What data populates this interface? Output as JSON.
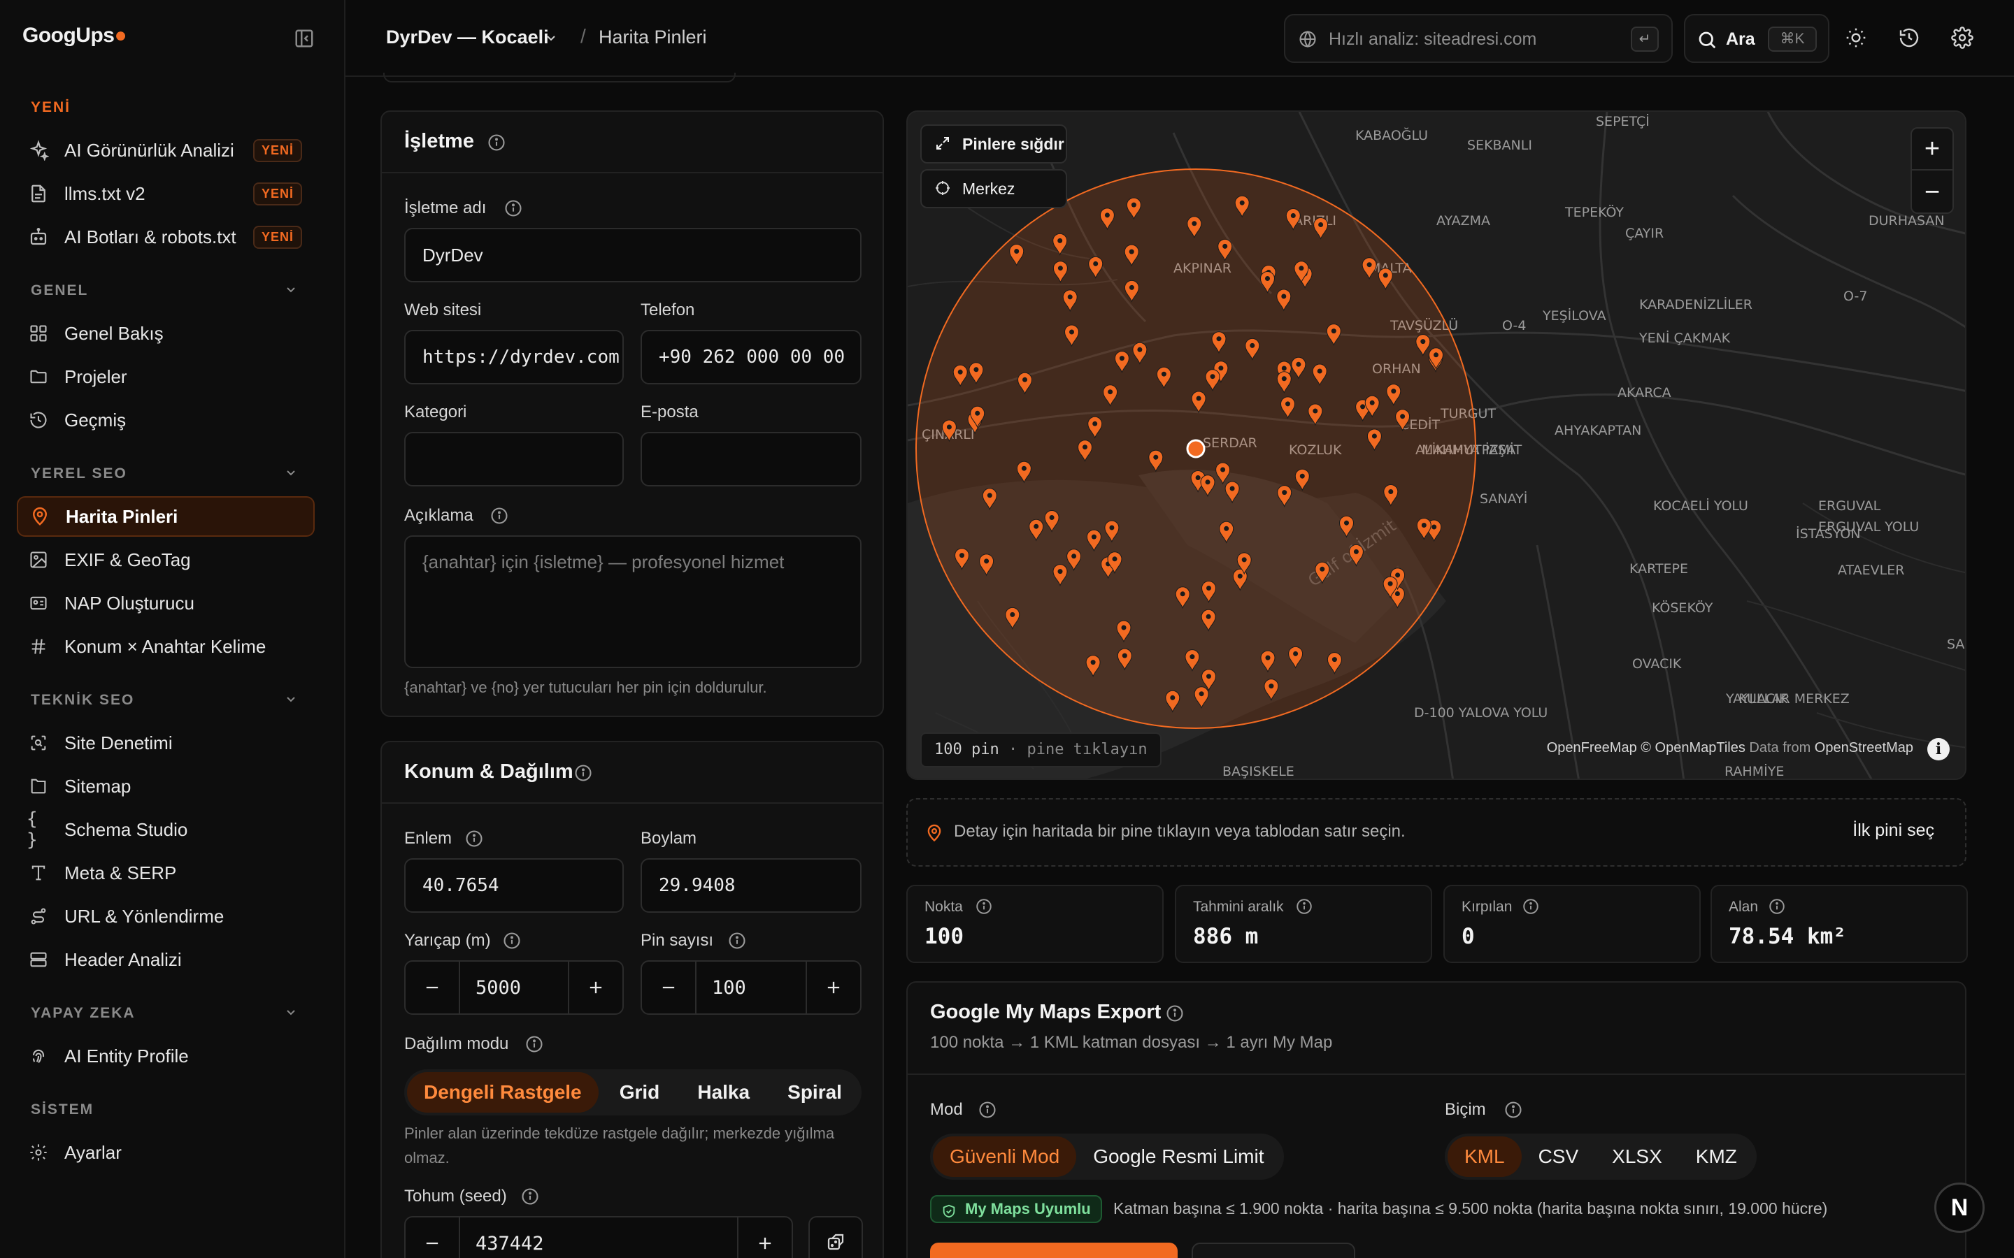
{
  "app": {
    "brand": "GoogUps",
    "accent": "#f26a21"
  },
  "sidebar": {
    "sections": [
      {
        "title": "YENİ",
        "items": [
          {
            "label": "AI Görünürlük Analizi",
            "badge": "YENİ",
            "icon": "sparkle-icon"
          },
          {
            "label": "llms.txt v2",
            "badge": "YENİ",
            "icon": "document-icon"
          },
          {
            "label": "AI Botları & robots.txt",
            "badge": "YENİ",
            "icon": "bot-icon"
          }
        ]
      },
      {
        "title": "GENEL",
        "items": [
          {
            "label": "Genel Bakış",
            "icon": "grid-icon"
          },
          {
            "label": "Projeler",
            "icon": "folder-icon"
          },
          {
            "label": "Geçmiş",
            "icon": "history-icon"
          }
        ]
      },
      {
        "title": "YEREL SEO",
        "items": [
          {
            "label": "Harita Pinleri",
            "icon": "map-pin-icon",
            "active": true
          },
          {
            "label": "EXIF & GeoTag",
            "icon": "image-icon"
          },
          {
            "label": "NAP Oluşturucu",
            "icon": "id-card-icon"
          },
          {
            "label": "Konum × Anahtar Kelime",
            "icon": "hash-icon"
          }
        ]
      },
      {
        "title": "TEKNİK SEO",
        "items": [
          {
            "label": "Site Denetimi",
            "icon": "scan-icon"
          },
          {
            "label": "Sitemap",
            "icon": "sitemap-icon"
          },
          {
            "label": "Schema Studio",
            "icon": "braces-icon"
          },
          {
            "label": "Meta & SERP",
            "icon": "type-icon"
          },
          {
            "label": "URL & Yönlendirme",
            "icon": "route-icon"
          },
          {
            "label": "Header Analizi",
            "icon": "server-icon"
          }
        ]
      },
      {
        "title": "YAPAY ZEKA",
        "items": [
          {
            "label": "AI Entity Profile",
            "icon": "fingerprint-icon"
          }
        ]
      },
      {
        "title": "SİSTEM",
        "items": [
          {
            "label": "Ayarlar",
            "icon": "gear-icon"
          }
        ]
      }
    ]
  },
  "topbar": {
    "project": "DyrDev — Kocaeli",
    "separator": "/",
    "page": "Harita Pinleri",
    "quick_placeholder": "Hızlı analiz: siteadresi.com",
    "enter_key": "↵",
    "search_label": "Ara",
    "search_shortcut": "⌘K"
  },
  "business": {
    "title": "İşletme",
    "name_label": "İşletme adı",
    "name_value": "DyrDev",
    "web_label": "Web sitesi",
    "web_value": "https://dyrdev.com",
    "phone_label": "Telefon",
    "phone_value": "+90 262 000 00 00",
    "category_label": "Kategori",
    "category_value": "",
    "email_label": "E-posta",
    "email_value": "",
    "desc_label": "Açıklama",
    "desc_placeholder": "{anahtar} için {isletme} — profesyonel hizmet",
    "desc_hint": "{anahtar} ve {no} yer tutucuları her pin için doldurulur."
  },
  "location": {
    "title": "Konum & Dağılım",
    "lat_label": "Enlem",
    "lat_value": "40.7654",
    "lng_label": "Boylam",
    "lng_value": "29.9408",
    "radius_label": "Yarıçap (m)",
    "radius_value": "5000",
    "pins_label": "Pin sayısı",
    "pins_value": "100",
    "mode_label": "Dağılım modu",
    "modes": [
      "Dengeli Rastgele",
      "Grid",
      "Halka",
      "Spiral"
    ],
    "active_mode": "Dengeli Rastgele",
    "mode_hint": "Pinler alan üzerinde tekdüze rastgele dağılır; merkezde yığılma olmaz.",
    "seed_label": "Tohum (seed)",
    "seed_value": "437442"
  },
  "map": {
    "fit_label": "Pinlere sığdır",
    "center_label": "Merkez",
    "zoom_in": "+",
    "zoom_out": "−",
    "pin_count": "100 pin",
    "pin_hint": "· pine tıklayın",
    "attribution_main": "OpenFreeMap © OpenMapTiles",
    "attribution_data": "Data from",
    "attribution_osm": "OpenStreetMap",
    "pin_color": "#f26a21",
    "places": [
      "KABAOĞLU",
      "SEKBANLI",
      "SEPETÇİ",
      "ARIZLI",
      "AYAZMA",
      "TEPEKÖY",
      "MALTA",
      "ÇAYIR",
      "DURHASAN",
      "AKPINAR",
      "YEŞİLOVA",
      "KARADENİZLİLER",
      "TAVŞÜZLÜ",
      "ORHAN",
      "YENİ ÇAKMAK",
      "O-4",
      "O-7",
      "TURGUT",
      "AKARCA",
      "ÇINARLI",
      "SERDAR",
      "KOZLUK",
      "CEDİT",
      "MAHMUTPAŞA",
      "İZMİT",
      "ALİKAHYA",
      "AHYAKAPTAN",
      "SANAYİ",
      "KOCAELİ YOLU",
      "ERGUVAL",
      "ERGUVAL YOLU",
      "İSTASYON",
      "KARTEPE",
      "ATAEVLER",
      "KÖSEKÖY",
      "SARI",
      "OVACIK",
      "YAYLACIK",
      "KULLAR MERKEZ",
      "D-100 YALOVA YOLU",
      "BAŞISKELE",
      "RAHMİYE",
      "Gulf of İzmit"
    ]
  },
  "detail": {
    "text": "Detay için haritada bir pine tıklayın veya tablodan satır seçin.",
    "action": "İlk pini seç"
  },
  "stats": [
    {
      "label": "Nokta",
      "value": "100"
    },
    {
      "label": "Tahmini aralık",
      "value": "886 m"
    },
    {
      "label": "Kırpılan",
      "value": "0"
    },
    {
      "label": "Alan",
      "value": "78.54 km²"
    }
  ],
  "export": {
    "title": "Google My Maps Export",
    "subtitle": "100 nokta → 1 KML katman dosyası → 1 ayrı My Map",
    "mode_label": "Mod",
    "modes": [
      "Güvenli Mod",
      "Google Resmi Limit"
    ],
    "active_mode": "Güvenli Mod",
    "format_label": "Biçim",
    "formats": [
      "KML",
      "CSV",
      "XLSX",
      "KMZ"
    ],
    "active_format": "KML",
    "compat_badge": "My Maps Uyumlu",
    "compat_note": "Katman başına ≤ 1.900 nokta · harita başına ≤ 9.500 nokta (harita başına nokta sınırı, 19.000 hücre)"
  },
  "fab": {
    "label": "N"
  }
}
